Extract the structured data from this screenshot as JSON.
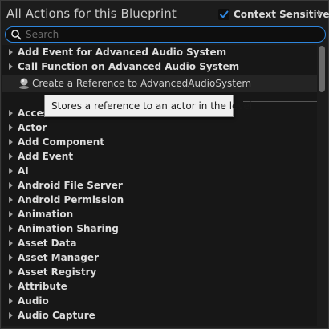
{
  "header": {
    "title": "All Actions for this Blueprint",
    "context_sensitive_label": "Context Sensitive",
    "context_sensitive_checked": true
  },
  "search": {
    "placeholder": "Search",
    "value": ""
  },
  "top_items": [
    {
      "label": "Add Event for Advanced Audio System"
    },
    {
      "label": "Call Function on Advanced Audio System"
    }
  ],
  "reference_item": {
    "label": "Create a Reference to AdvancedAudioSystem",
    "icon": "actor-reference-icon"
  },
  "tooltip": {
    "text": "Stores a reference to an actor in the level"
  },
  "categories": [
    {
      "label": "Acces"
    },
    {
      "label": "Actor"
    },
    {
      "label": "Add Component"
    },
    {
      "label": "Add Event"
    },
    {
      "label": "AI"
    },
    {
      "label": "Android File Server"
    },
    {
      "label": "Android Permission"
    },
    {
      "label": "Animation"
    },
    {
      "label": "Animation Sharing"
    },
    {
      "label": "Asset Data"
    },
    {
      "label": "Asset Manager"
    },
    {
      "label": "Asset Registry"
    },
    {
      "label": "Attribute"
    },
    {
      "label": "Audio"
    },
    {
      "label": "Audio Capture"
    }
  ],
  "colors": {
    "accent": "#2e86de",
    "background": "#1c1c1c",
    "list_background": "#171717",
    "tooltip_background": "#f0f0f0"
  }
}
